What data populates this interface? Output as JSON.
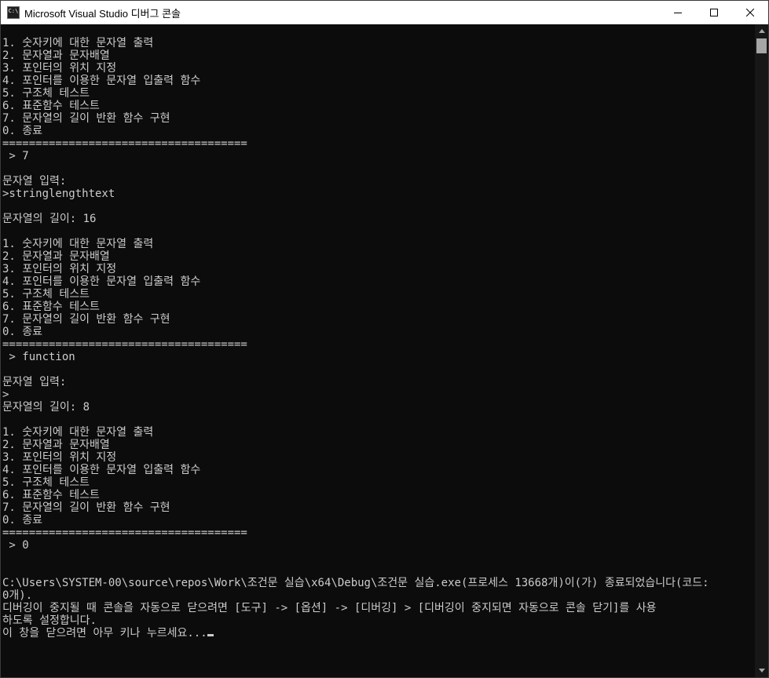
{
  "window": {
    "icon_text": "C:\\",
    "title": "Microsoft Visual Studio 디버그 콘솔"
  },
  "console": {
    "lines": [
      "1. 숫자키에 대한 문자열 출력",
      "2. 문자열과 문자배열",
      "3. 포인터의 위치 지정",
      "4. 포인터를 이용한 문자열 입출력 함수",
      "5. 구조체 테스트",
      "6. 표준함수 테스트",
      "7. 문자열의 길이 반환 함수 구현",
      "0. 종료",
      "=====================================",
      " > 7",
      "",
      "문자열 입력:",
      ">stringlengthtext",
      "",
      "문자열의 길이: 16",
      "",
      "1. 숫자키에 대한 문자열 출력",
      "2. 문자열과 문자배열",
      "3. 포인터의 위치 지정",
      "4. 포인터를 이용한 문자열 입출력 함수",
      "5. 구조체 테스트",
      "6. 표준함수 테스트",
      "7. 문자열의 길이 반환 함수 구현",
      "0. 종료",
      "=====================================",
      " > function",
      "",
      "문자열 입력:",
      ">",
      "문자열의 길이: 8",
      "",
      "1. 숫자키에 대한 문자열 출력",
      "2. 문자열과 문자배열",
      "3. 포인터의 위치 지정",
      "4. 포인터를 이용한 문자열 입출력 함수",
      "5. 구조체 테스트",
      "6. 표준함수 테스트",
      "7. 문자열의 길이 반환 함수 구현",
      "0. 종료",
      "=====================================",
      " > 0",
      "",
      "",
      "C:\\Users\\SYSTEM-00\\source\\repos\\Work\\조건문 실습\\x64\\Debug\\조건문 실습.exe(프로세스 13668개)이(가) 종료되었습니다(코드:",
      "0개).",
      "디버깅이 중지될 때 콘솔을 자동으로 닫으려면 [도구] -> [옵션] -> [디버깅] > [디버깅이 중지되면 자동으로 콘솔 닫기]를 사용",
      "하도록 설정합니다.",
      "이 창을 닫으려면 아무 키나 누르세요..."
    ]
  },
  "colors": {
    "background": "#0c0c0c",
    "text": "#cccccc",
    "titlebar": "#ffffff"
  },
  "icons": {
    "minimize": "minimize-icon",
    "maximize": "maximize-icon",
    "close": "close-icon"
  }
}
